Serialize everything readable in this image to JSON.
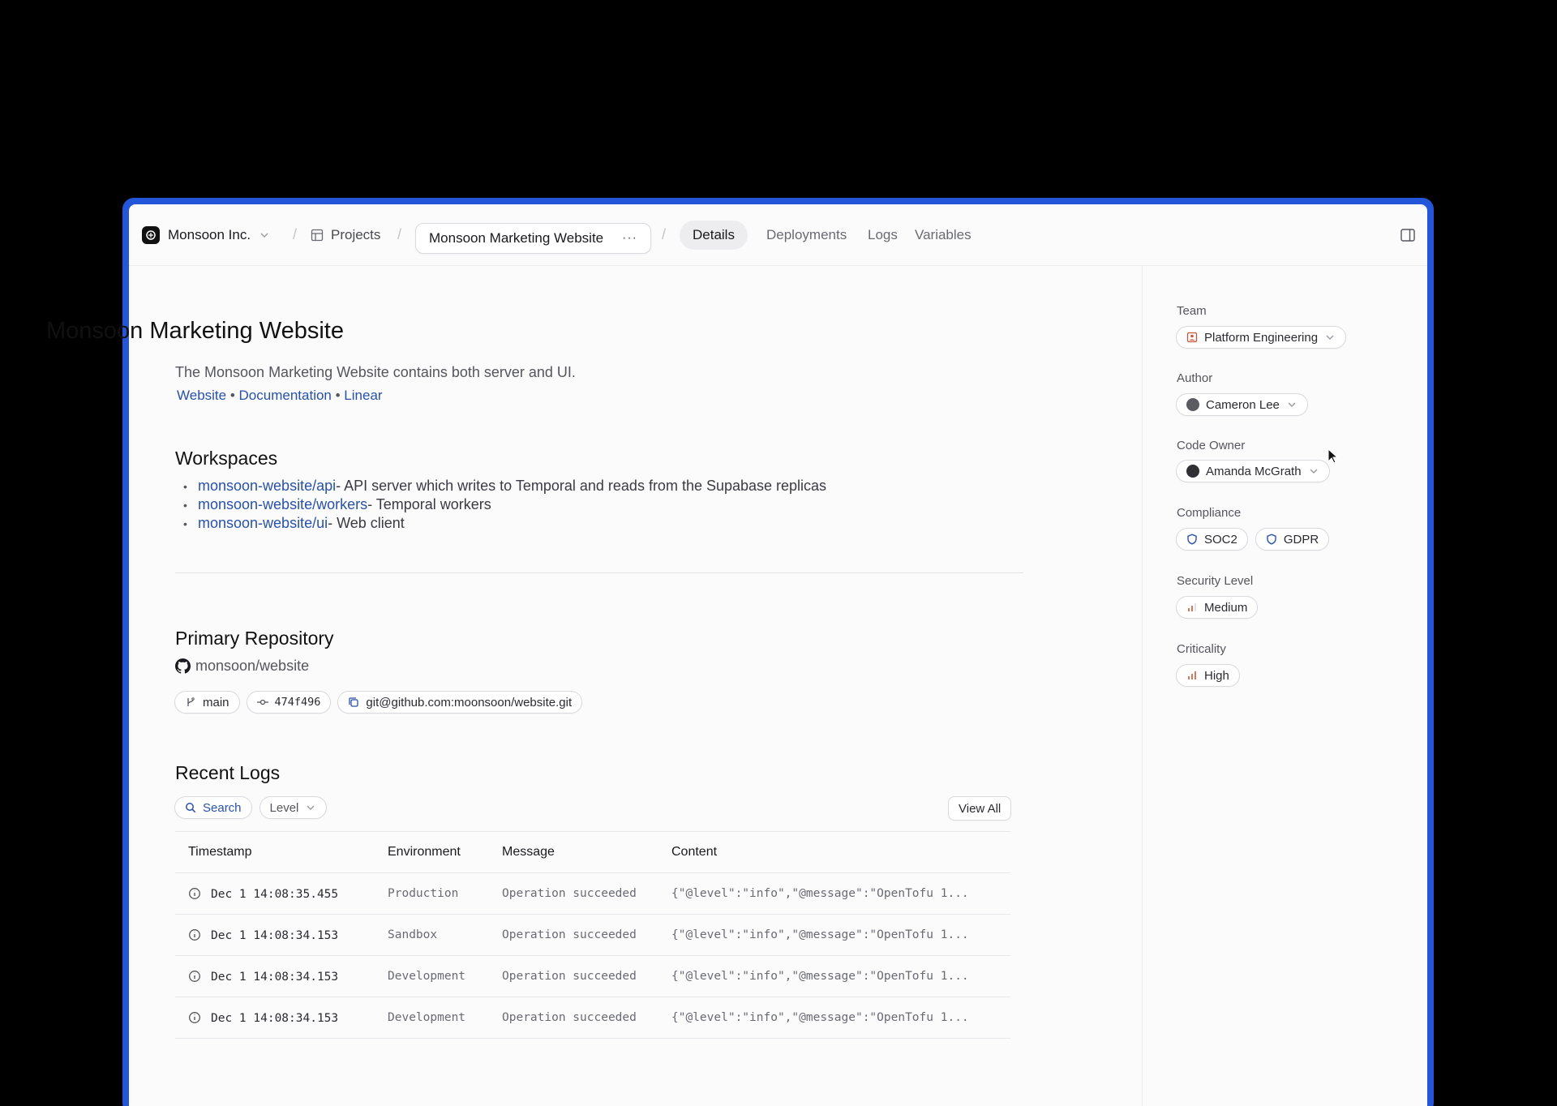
{
  "nav": {
    "org": "Monsoon Inc.",
    "projects": "Projects",
    "project": "Monsoon Marketing Website",
    "more": "···",
    "separator": "/",
    "tabs": [
      "Details",
      "Deployments",
      "Logs",
      "Variables"
    ]
  },
  "project": {
    "title": "Monsoon Marketing Website",
    "description": "The Monsoon Marketing Website contains both server and UI.",
    "links": [
      "Website",
      "Documentation",
      "Linear"
    ],
    "link_separator": "•"
  },
  "workspaces": {
    "heading": "Workspaces",
    "items": [
      {
        "name": "monsoon-website/api",
        "desc": " - API server which writes to Temporal and reads from the Supabase replicas"
      },
      {
        "name": "monsoon-website/workers",
        "desc": " - Temporal workers"
      },
      {
        "name": "monsoon-website/ui",
        "desc": " - Web client"
      }
    ]
  },
  "repository": {
    "heading": "Primary Repository",
    "name": "monsoon/website",
    "branch": "main",
    "commit": "474f496",
    "remote": "git@github.com:moonsoon/website.git"
  },
  "logs": {
    "heading": "Recent Logs",
    "search_label": "Search",
    "level_label": "Level",
    "view_all": "View All",
    "columns": [
      "Timestamp",
      "Environment",
      "Message",
      "Content"
    ],
    "rows": [
      {
        "timestamp": "Dec 1 14:08:35.455",
        "environment": "Production",
        "message": "Operation succeeded",
        "content": "{\"@level\":\"info\",\"@message\":\"OpenTofu 1..."
      },
      {
        "timestamp": "Dec 1 14:08:34.153",
        "environment": "Sandbox",
        "message": "Operation succeeded",
        "content": "{\"@level\":\"info\",\"@message\":\"OpenTofu 1..."
      },
      {
        "timestamp": "Dec 1 14:08:34.153",
        "environment": "Development",
        "message": "Operation succeeded",
        "content": "{\"@level\":\"info\",\"@message\":\"OpenTofu 1..."
      },
      {
        "timestamp": "Dec 1 14:08:34.153",
        "environment": "Development",
        "message": "Operation succeeded",
        "content": "{\"@level\":\"info\",\"@message\":\"OpenTofu 1..."
      }
    ]
  },
  "sidebar": {
    "team_label": "Team",
    "team": "Platform Engineering",
    "author_label": "Author",
    "author": "Cameron Lee",
    "code_owner_label": "Code Owner",
    "code_owner": "Amanda McGrath",
    "compliance_label": "Compliance",
    "compliance": [
      "SOC2",
      "GDPR"
    ],
    "security_label": "Security Level",
    "security": "Medium",
    "criticality_label": "Criticality",
    "criticality": "High"
  },
  "colors": {
    "frame": "#2356d8",
    "link": "#2851a8",
    "team_icon": "#c9553a",
    "level_icon": "#d9775a"
  }
}
